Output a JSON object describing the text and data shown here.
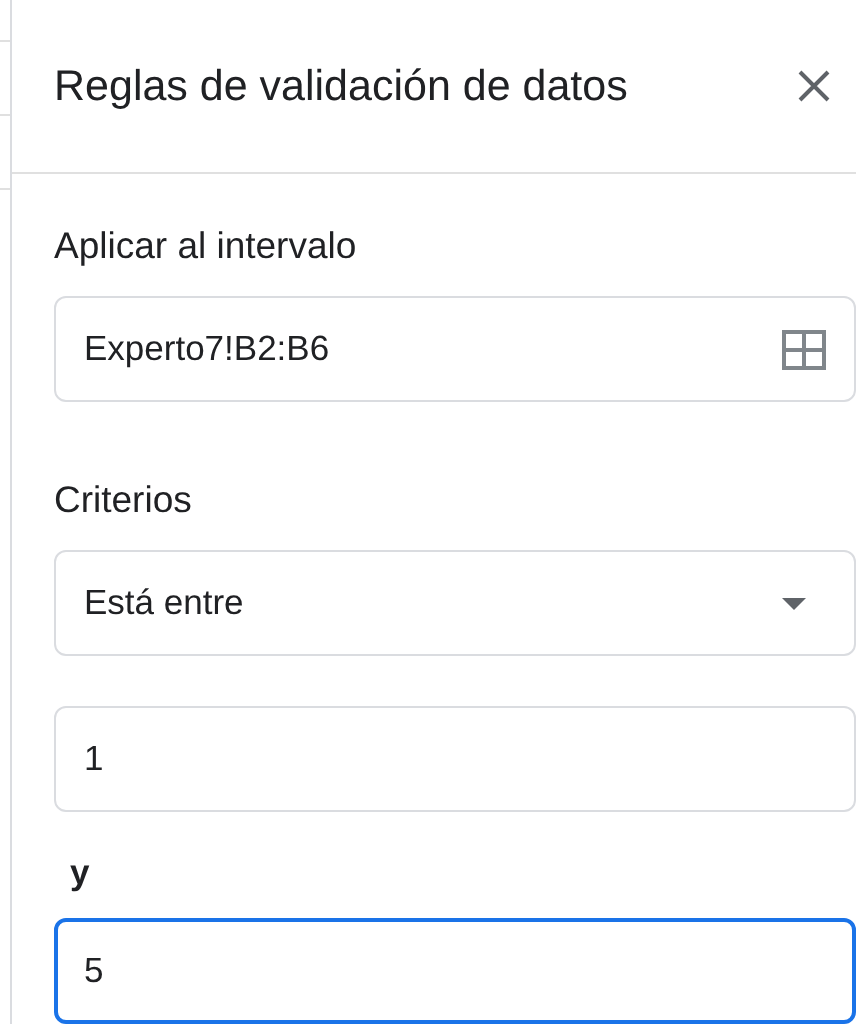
{
  "panel": {
    "title": "Reglas de validación de datos"
  },
  "range": {
    "label": "Aplicar al intervalo",
    "value": "Experto7!B2:B6"
  },
  "criteria": {
    "label": "Criterios",
    "dropdown": "Está entre"
  },
  "values": [
    {
      "value": "1",
      "focused": false
    },
    {
      "value": "5",
      "focused": true
    }
  ],
  "joiner": "y"
}
